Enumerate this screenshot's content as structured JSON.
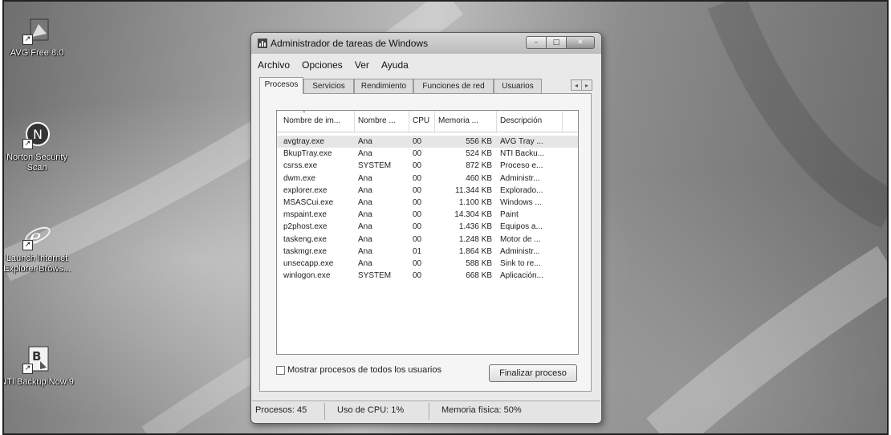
{
  "desktop": {
    "icons": [
      {
        "label": "AVG Free 8.0",
        "icon": "avg-icon"
      },
      {
        "label": "Norton Security Scan",
        "icon": "norton-icon"
      },
      {
        "label": "Launch Internet Explorer Brows...",
        "icon": "internet-explorer-icon"
      },
      {
        "label": "NTI Backup Now 9",
        "icon": "nti-backup-icon"
      }
    ]
  },
  "window": {
    "title": "Administrador de tareas de Windows",
    "controls": {
      "minimize": "–",
      "maximize": "□",
      "close": "✕"
    },
    "menu": [
      "Archivo",
      "Opciones",
      "Ver",
      "Ayuda"
    ],
    "tabs": [
      "Procesos",
      "Servicios",
      "Rendimiento",
      "Funciones de red",
      "Usuarios"
    ],
    "active_tab": "Procesos",
    "tab_scroll": {
      "left": "◂",
      "right": "▸"
    },
    "processes": {
      "columns": [
        "Nombre de im...",
        "Nombre ...",
        "CPU",
        "Memoria ...",
        "Descripción"
      ],
      "sort_indicator": "^",
      "rows": [
        [
          "avgtray.exe",
          "Ana",
          "00",
          "556 KB",
          "AVG Tray ..."
        ],
        [
          "BkupTray.exe",
          "Ana",
          "00",
          "524 KB",
          "NTI Backu..."
        ],
        [
          "csrss.exe",
          "SYSTEM",
          "00",
          "872 KB",
          "Proceso e..."
        ],
        [
          "dwm.exe",
          "Ana",
          "00",
          "460 KB",
          "Administr..."
        ],
        [
          "explorer.exe",
          "Ana",
          "00",
          "11.344 KB",
          "Explorado..."
        ],
        [
          "MSASCui.exe",
          "Ana",
          "00",
          "1.100 KB",
          "Windows ..."
        ],
        [
          "mspaint.exe",
          "Ana",
          "00",
          "14.304 KB",
          "Paint"
        ],
        [
          "p2phost.exe",
          "Ana",
          "00",
          "1.436 KB",
          "Equipos a..."
        ],
        [
          "taskeng.exe",
          "Ana",
          "00",
          "1.248 KB",
          "Motor de ..."
        ],
        [
          "taskmgr.exe",
          "Ana",
          "01",
          "1.864 KB",
          "Administr..."
        ],
        [
          "unsecapp.exe",
          "Ana",
          "00",
          "588 KB",
          "Sink to re..."
        ],
        [
          "winlogon.exe",
          "SYSTEM",
          "00",
          "668 KB",
          "Aplicación..."
        ]
      ]
    },
    "show_all_users_label": "Mostrar procesos de todos los usuarios",
    "show_all_users_checked": false,
    "end_process_label": "Finalizar proceso",
    "status": {
      "processes": "Procesos: 45",
      "cpu": "Uso de CPU: 1%",
      "memory": "Memoria física: 50%"
    }
  }
}
